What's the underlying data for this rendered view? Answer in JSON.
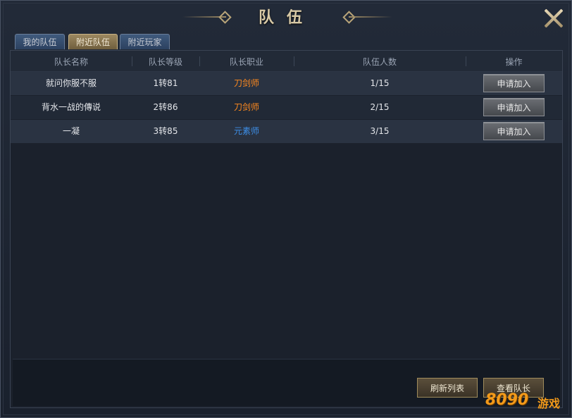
{
  "window": {
    "title": "队伍"
  },
  "tabs": [
    {
      "label": "我的队伍",
      "active": false
    },
    {
      "label": "附近队伍",
      "active": true
    },
    {
      "label": "附近玩家",
      "active": false
    }
  ],
  "table": {
    "headers": [
      "队长名称",
      "队长等级",
      "队长职业",
      "队伍人数",
      "操作"
    ],
    "rows": [
      {
        "name": "就问你服不服",
        "level": "1转81",
        "class": "刀剑师",
        "class_color": "#ff8a1e",
        "members": "1/15",
        "action": "申请加入"
      },
      {
        "name": "背水一战的傳说",
        "level": "2转86",
        "class": "刀剑师",
        "class_color": "#ff8a1e",
        "members": "2/15",
        "action": "申请加入"
      },
      {
        "name": "一凝",
        "level": "3转85",
        "class": "元素师",
        "class_color": "#3d8fe8",
        "members": "3/15",
        "action": "申请加入"
      }
    ]
  },
  "footer": {
    "refresh_label": "刷新列表",
    "view_leader_label": "查看队长"
  },
  "watermark": {
    "text": "8090",
    "suffix": "游戏"
  },
  "icons": {
    "close": "close-x-icon"
  },
  "colors": {
    "accent_gold": "#c8b284",
    "warrior_orange": "#ff8a1e",
    "mage_blue": "#3d8fe8"
  }
}
